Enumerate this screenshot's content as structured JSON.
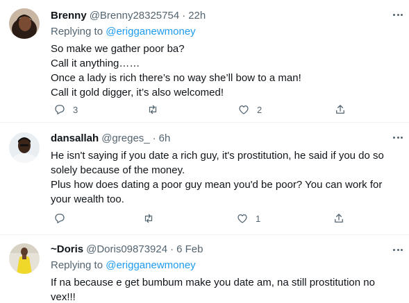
{
  "tweets": [
    {
      "name": "Brenny",
      "handle": "@Brenny28325754",
      "separator": "·",
      "time": "22h",
      "replying_prefix": "Replying to",
      "replying_to": "@erigganewmoney",
      "lines": [
        "So make we gather poor ba?",
        "Call it anything……",
        "Once a lady is rich there’s no way she’ll bow to a man!",
        "Call it gold digger, it’s also welcomed!"
      ],
      "reply_count": "3",
      "retweet_count": "",
      "like_count": "2"
    },
    {
      "name": "dansallah",
      "handle": "@greges_",
      "separator": "·",
      "time": "6h",
      "lines": [
        "He isn't saying if you date a rich guy, it's prostitution, he said if you do so",
        "solely because of the money.",
        "Plus how does dating a poor guy mean you'd be poor? You can work for",
        "your wealth too."
      ],
      "reply_count": "",
      "retweet_count": "",
      "like_count": "1"
    },
    {
      "name": "~Doris",
      "handle": "@Doris09873924",
      "separator": "·",
      "time": "6 Feb",
      "replying_prefix": "Replying to",
      "replying_to": "@erigganewmoney",
      "lines": [
        "If na because e get bumbum make you date am, na still prostitution no",
        "vex!!!"
      ]
    }
  ],
  "colors": {
    "text_primary": "#0f1419",
    "text_secondary": "#536471",
    "accent": "#1d9bf0",
    "divider": "#eff3f4"
  },
  "icons": [
    "reply-icon",
    "retweet-icon",
    "like-icon",
    "share-icon",
    "more-icon"
  ]
}
